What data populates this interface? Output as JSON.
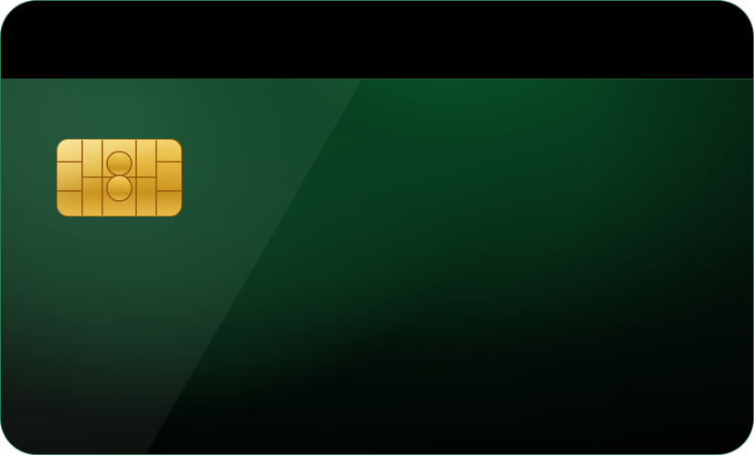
{
  "card": {
    "colors": {
      "base": "#0b2f1b",
      "highlight": "#0a5a2c",
      "stripe": "#000000",
      "border": "#2e7d55",
      "chip_gold": "#d9a92c",
      "chip_line": "#9a5a10"
    },
    "icons": {
      "chip": "emv-chip-icon",
      "stripe": "magnetic-stripe"
    }
  }
}
